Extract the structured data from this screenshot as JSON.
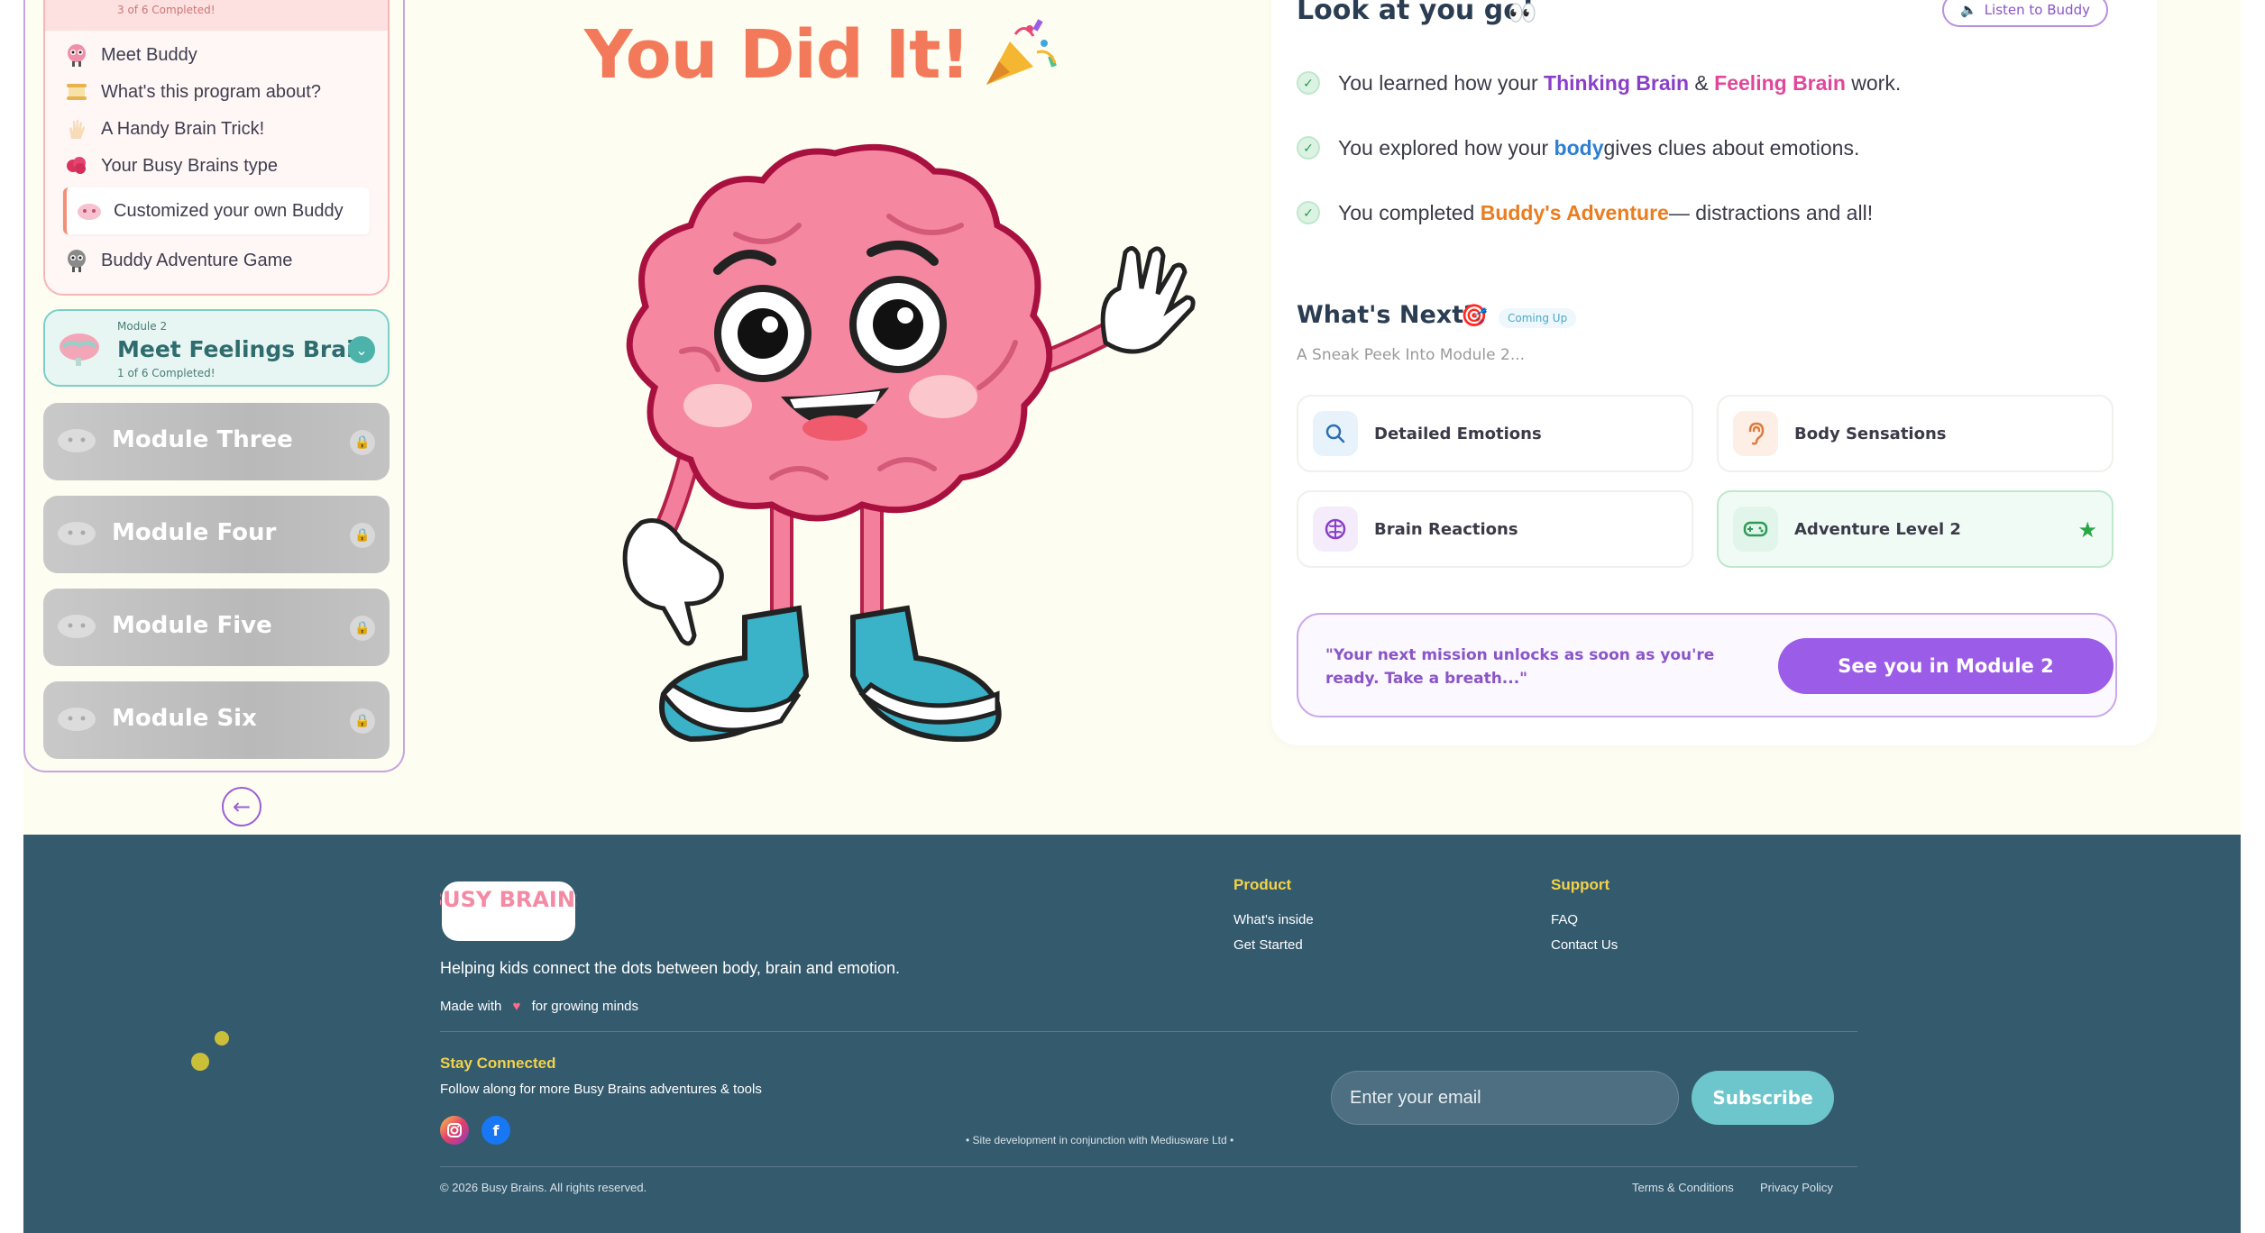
{
  "sidebar": {
    "module1": {
      "progress_text": "3 of 6 Completed!",
      "lessons": [
        {
          "label": "Meet Buddy",
          "icon": "brain-buddy-icon"
        },
        {
          "label": "What's this program about?",
          "icon": "scroll-icon"
        },
        {
          "label": "A Handy Brain Trick!",
          "icon": "hand-icon"
        },
        {
          "label": "Your Busy Brains type",
          "icon": "brain-icon"
        },
        {
          "label": "Customized your own Buddy",
          "icon": "customize-icon"
        },
        {
          "label": "Buddy Adventure Game",
          "icon": "game-buddy-icon"
        }
      ]
    },
    "module2": {
      "label": "Module 2",
      "title": "Meet Feelings Brain",
      "progress_text": "1 of 6 Completed!"
    },
    "locked_modules": [
      {
        "title": "Module Three"
      },
      {
        "title": "Module Four"
      },
      {
        "title": "Module Five"
      },
      {
        "title": "Module Six"
      }
    ],
    "back_icon": "arrow-left-icon"
  },
  "hero": {
    "title": "You Did It!",
    "icon": "party-popper-icon"
  },
  "panel": {
    "title": "Look at you go!",
    "title_icon": "eyes-icon",
    "listen_label": "Listen to Buddy",
    "achievements": [
      {
        "pre": "You learned how your ",
        "h1": "Thinking Brain",
        "mid": " & ",
        "h2": "Feeling Brain",
        "post": " work."
      },
      {
        "pre": "You explored how your ",
        "h1": "body",
        "post": "gives clues about emotions."
      },
      {
        "pre": "You completed ",
        "h1": "Buddy's Adventure",
        "post": "— distractions and all!"
      }
    ],
    "next": {
      "title": "What's Next?",
      "badge": "Coming Up",
      "subtitle": "A Sneak Peek Into Module 2...",
      "cards": [
        {
          "label": "Detailed Emotions",
          "icon": "search-icon"
        },
        {
          "label": "Body Sensations",
          "icon": "ear-icon"
        },
        {
          "label": "Brain Reactions",
          "icon": "brain-outline-icon"
        },
        {
          "label": "Adventure Level 2",
          "icon": "gamepad-icon"
        }
      ]
    },
    "mission": {
      "quote": "\"Your next mission unlocks as soon as you're ready. Take a breath...\"",
      "cta": "See you in Module 2"
    }
  },
  "footer": {
    "logo_text": "BUSY BRAINS",
    "tagline": "Helping kids connect the dots between body, brain and emotion.",
    "made_with_pre": "Made with",
    "made_with_post": "for growing minds",
    "product": {
      "heading": "Product",
      "links": [
        "What's inside",
        "Get Started"
      ]
    },
    "support": {
      "heading": "Support",
      "links": [
        "FAQ",
        "Contact Us"
      ]
    },
    "stay": {
      "heading": "Stay Connected",
      "sub": "Follow along for more Busy Brains adventures & tools"
    },
    "social": [
      {
        "icon": "instagram-icon"
      },
      {
        "icon": "facebook-icon"
      }
    ],
    "site_dev": "• Site development in conjunction with Mediusware Ltd •",
    "email_placeholder": "Enter your email",
    "subscribe_label": "Subscribe",
    "copyright": "© 2026 Busy Brains. All rights reserved.",
    "legal": [
      "Terms & Conditions",
      "Privacy Policy"
    ]
  },
  "colors": {
    "accent_purple": "#9b5ce8",
    "title_coral": "#f27a5a",
    "footer_bg": "#345a6e",
    "teal": "#6cc6cc"
  }
}
